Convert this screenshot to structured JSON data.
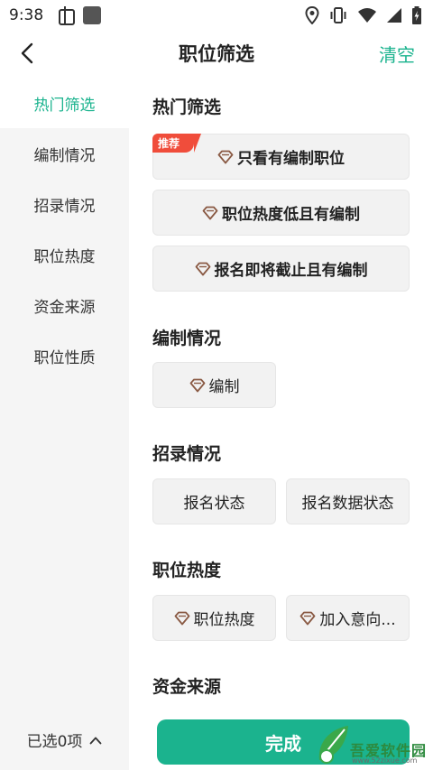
{
  "status_bar": {
    "time": "9:38",
    "left_icons": [
      "bug-icon",
      "square-icon"
    ],
    "right_icons": [
      "location-icon",
      "vibrate-icon",
      "wifi-icon",
      "signal-icon",
      "battery-charging-icon"
    ]
  },
  "header": {
    "title": "职位筛选",
    "clear_label": "清空"
  },
  "sidebar": {
    "items": [
      {
        "label": "热门筛选",
        "active": true
      },
      {
        "label": "编制情况",
        "active": false
      },
      {
        "label": "招录情况",
        "active": false
      },
      {
        "label": "职位热度",
        "active": false
      },
      {
        "label": "资金来源",
        "active": false
      },
      {
        "label": "职位性质",
        "active": false
      }
    ]
  },
  "sections": {
    "hot": {
      "title": "热门筛选",
      "badge": "推荐",
      "chips": [
        "只看有编制职位",
        "职位热度低且有编制",
        "报名即将截止且有编制"
      ]
    },
    "staffing": {
      "title": "编制情况",
      "chips": [
        "编制"
      ]
    },
    "recruit": {
      "title": "招录情况",
      "chips": [
        "报名状态",
        "报名数据状态"
      ]
    },
    "heat": {
      "title": "职位热度",
      "chips": [
        "职位热度",
        "加入意向..."
      ]
    },
    "funding": {
      "title": "资金来源"
    }
  },
  "bottom": {
    "selected_label": "已选0项",
    "done_label": "完成"
  },
  "watermark": {
    "text": "吾爱软件园",
    "url": "www.52zixue.com"
  },
  "colors": {
    "accent": "#1bb38e",
    "badge": "#f04d3b",
    "sidebar_bg": "#f5f5f5",
    "chip_bg": "#f2f2f2"
  }
}
